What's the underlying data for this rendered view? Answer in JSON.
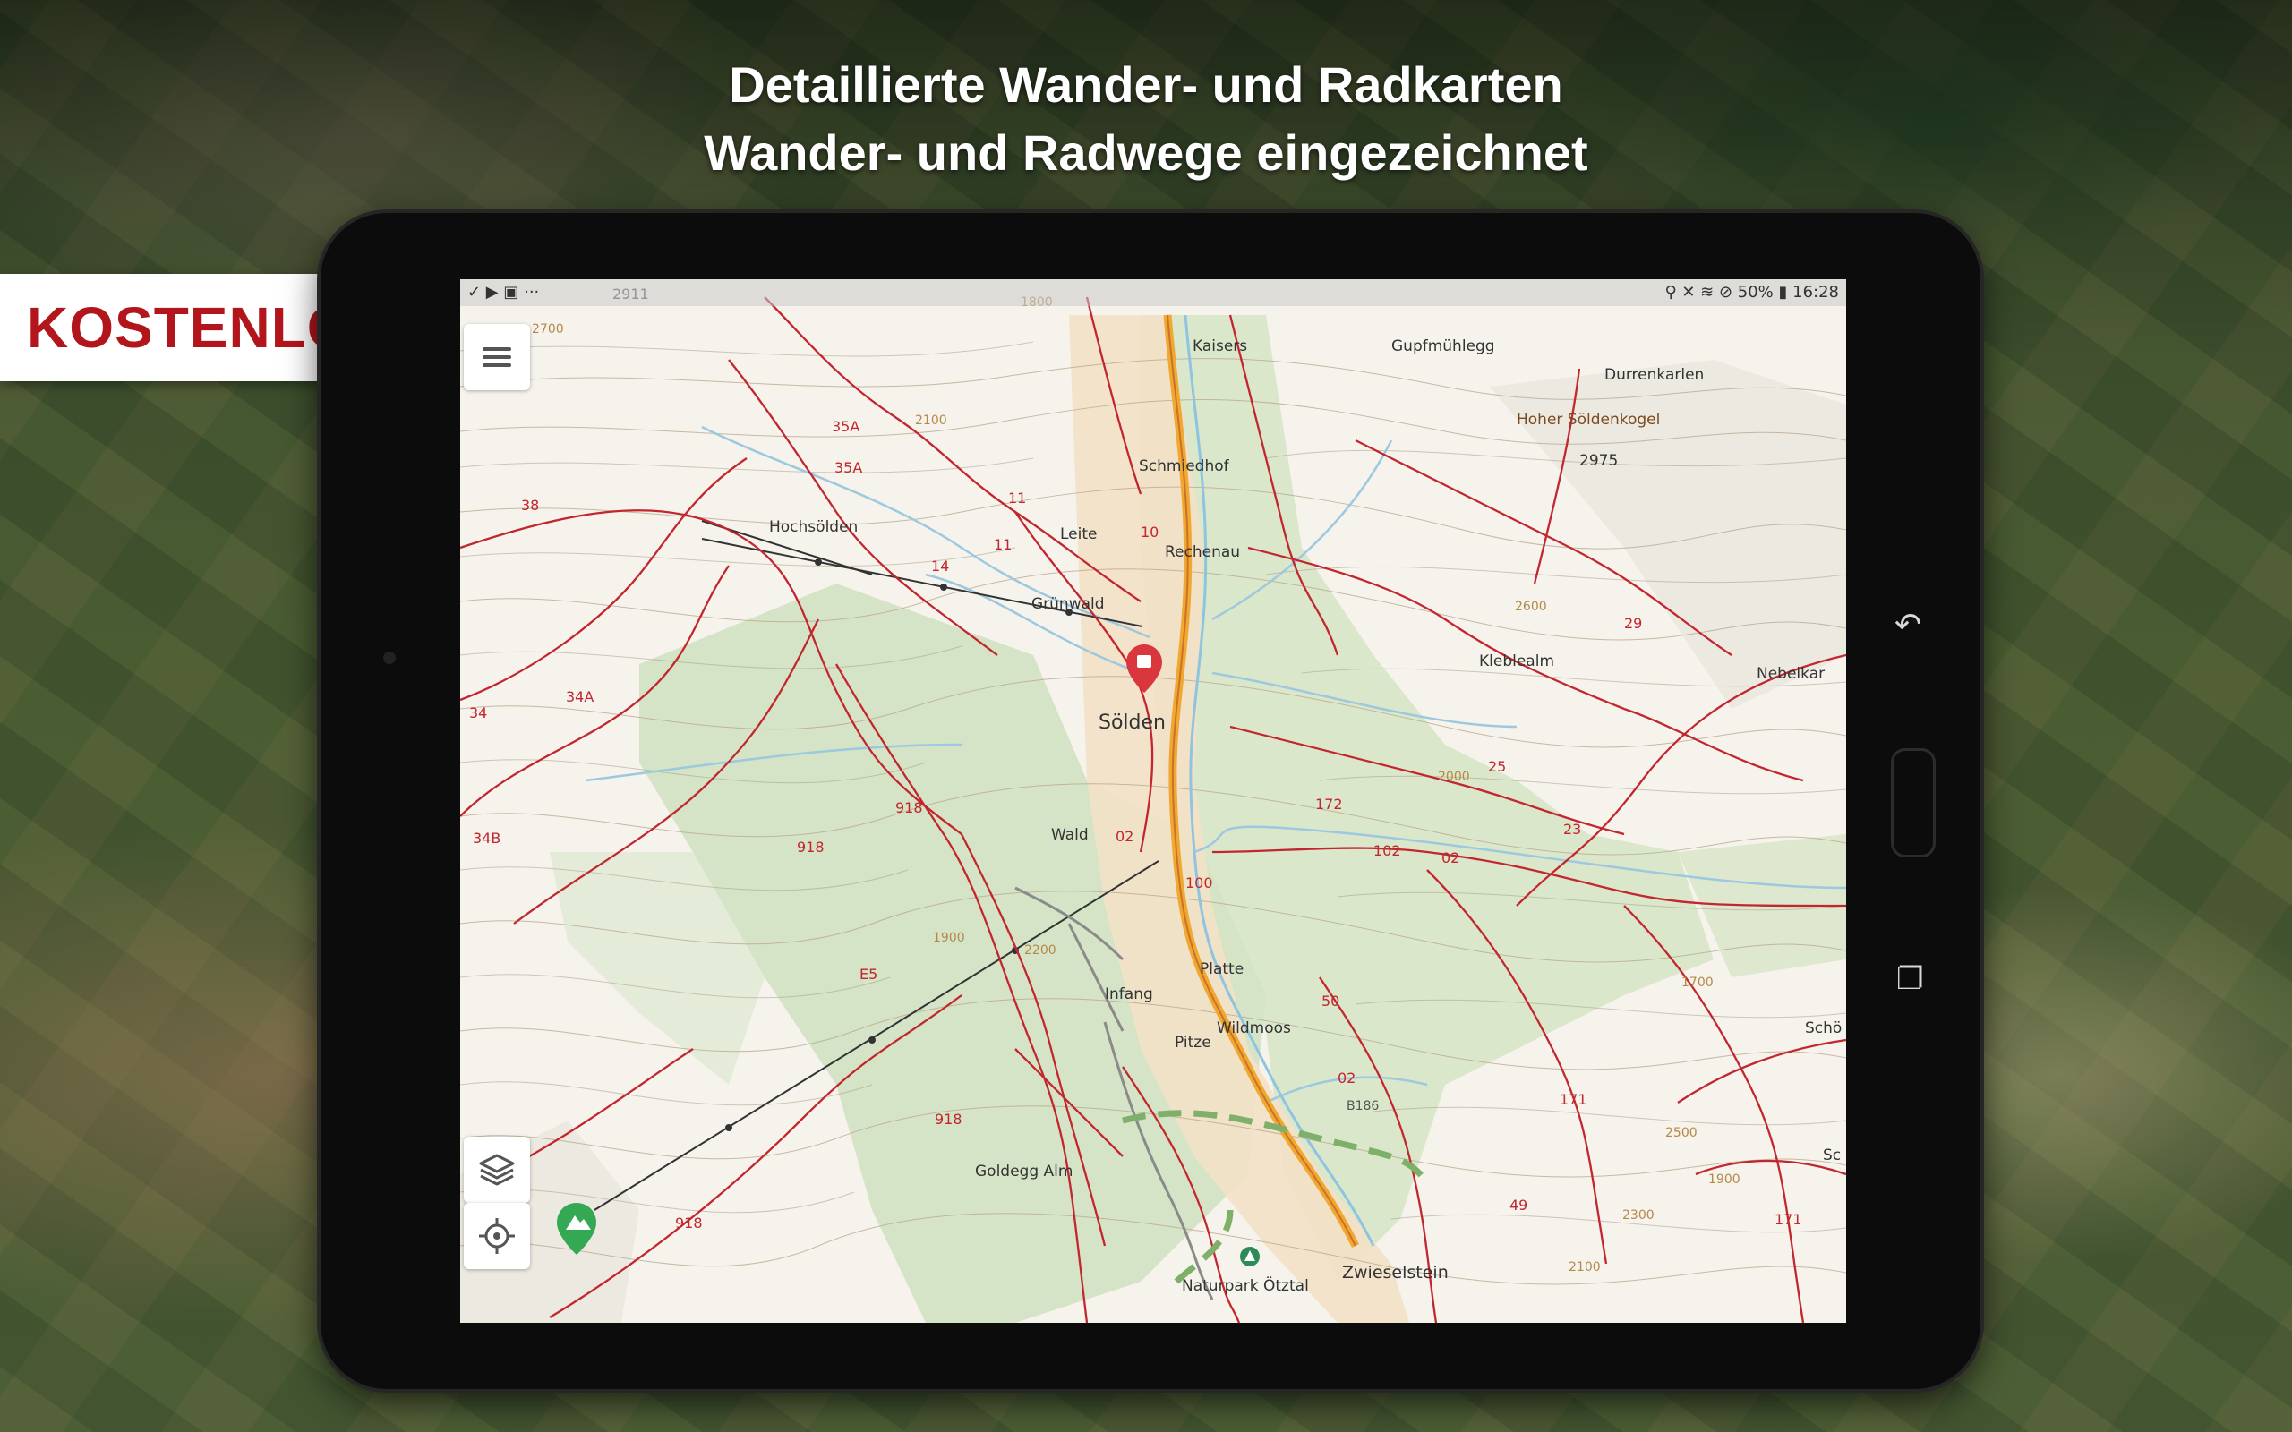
{
  "promo": {
    "headline_1": "Detaillierte Wander- und Radkarten",
    "headline_2": "Wander- und Radwege eingezeichnet",
    "badge": "KOSTENLOS"
  },
  "statusbar": {
    "left": "✓ ▶ ▣  ···",
    "right": "⚲ ✕ ≋ ⊘ 50% ▮ 16:28"
  },
  "map": {
    "places": {
      "soelden": "Sölden",
      "kaisers": "Kaisers",
      "gupfmuehlegg": "Gupfmühlegg",
      "durrenkarlen": "Durrenkarlen",
      "hoher_soeldenkogel": "Hoher Söldenkogel",
      "hoher_soeldenkogel_alt": "2975",
      "schmiedhof": "Schmiedhof",
      "hochsoelden": "Hochsölden",
      "leite": "Leite",
      "rechenau": "Rechenau",
      "gruenwald": "Grünwald",
      "kleblealm": "Kleblealm",
      "nebelkar": "Nebelkar",
      "wald": "Wald",
      "platte": "Platte",
      "infang": "Infang",
      "wildmoos": "Wildmoos",
      "pitze": "Pitze",
      "goldegg_alm": "Goldegg Alm",
      "naturpark": "Naturpark Ötztal",
      "zwieselstein": "Zwieselstein",
      "scho": "Schö",
      "sc": "Sc"
    },
    "routes": [
      "35A",
      "35A",
      "38",
      "11",
      "11",
      "10",
      "14",
      "34",
      "34A",
      "34B",
      "918",
      "918",
      "918",
      "918",
      "E5",
      "02",
      "02",
      "02",
      "100",
      "102",
      "172",
      "25",
      "23",
      "29",
      "50",
      "49",
      "171",
      "171"
    ],
    "contours": [
      "2911",
      "2700",
      "2100",
      "1800",
      "1900",
      "2200",
      "2600",
      "2000",
      "2500",
      "2300",
      "2100",
      "1900",
      "1700",
      "B186"
    ]
  },
  "controls": {
    "menu": "menu-icon",
    "layers": "layers-icon",
    "locate": "crosshair-icon"
  }
}
